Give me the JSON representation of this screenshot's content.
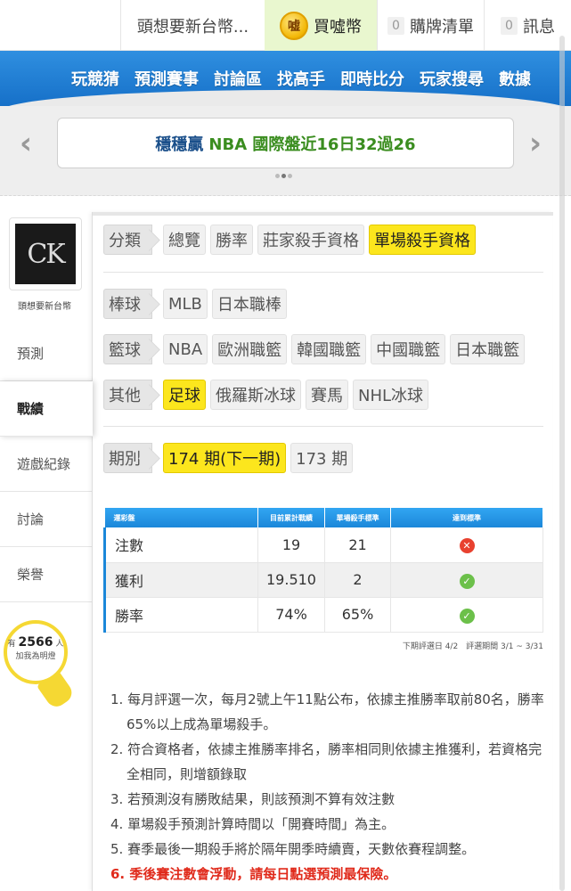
{
  "topbar": {
    "username": "頭想要新台幣...",
    "coin_icon_text": "嘘",
    "buy_label": "買噓幣",
    "list_count": "0",
    "list_label": "購牌清單",
    "msg_count": "0",
    "msg_label": "訊息"
  },
  "nav": {
    "items": [
      "玩競猜",
      "預測賽事",
      "討論區",
      "找高手",
      "即時比分",
      "玩家搜尋",
      "數據"
    ]
  },
  "banner": {
    "prev": "‹",
    "next": "›",
    "part1": "穩穩贏",
    "part2": "NBA 國際盤近16日32過26"
  },
  "sidebar": {
    "avatar_text": "CK",
    "username": "頭想要新台幣",
    "items": [
      "預測",
      "戰績",
      "遊戲紀錄",
      "討論",
      "榮譽"
    ],
    "bulb_prefix": "有",
    "bulb_count": "2566",
    "bulb_suffix": "人",
    "bulb_text": "加我為明燈"
  },
  "filters": {
    "category": {
      "label": "分類",
      "options": [
        "總覽",
        "勝率",
        "莊家殺手資格",
        "單場殺手資格"
      ],
      "selected": "單場殺手資格"
    },
    "baseball": {
      "label": "棒球",
      "options": [
        "MLB",
        "日本職棒"
      ]
    },
    "basketball": {
      "label": "籃球",
      "options": [
        "NBA",
        "歐洲職籃",
        "韓國職籃",
        "中國職籃",
        "日本職籃"
      ]
    },
    "other": {
      "label": "其他",
      "options": [
        "足球",
        "俄羅斯冰球",
        "賽馬",
        "NHL冰球"
      ],
      "selected": "足球"
    },
    "period": {
      "label": "期別",
      "options": [
        "174 期(下一期)",
        "173 期"
      ],
      "selected": "174 期(下一期)"
    }
  },
  "table": {
    "headers": [
      "運彩盤",
      "目前累計戰績",
      "單場殺手標準",
      "達到標準"
    ],
    "rows": [
      {
        "name": "注數",
        "current": "19",
        "standard": "21",
        "met": false
      },
      {
        "name": "獲利",
        "current": "19.510",
        "standard": "2",
        "met": true
      },
      {
        "name": "勝率",
        "current": "74%",
        "standard": "65%",
        "met": true
      }
    ],
    "fail_glyph": "✕",
    "pass_glyph": "✓"
  },
  "period_note": "下期評選日 4/2　評選期間 3/1 ~ 3/31",
  "rules": [
    "1. 每月評選一次，每月2號上午11點公布，依據主推勝率取前80名，勝率65%以上成為單場殺手。",
    "2. 符合資格者，依據主推勝率排名，勝率相同則依據主推獲利，若資格完全相同，則增額錄取",
    "3. 若預測沒有勝敗結果，則該預測不算有效注數",
    "4. 單場殺手預測計算時間以「開賽時間」為主。",
    "5. 賽季最後一期殺手將於隔年開季時續賣，天數依賽程調整。",
    "6. 季後賽注數會浮動，請每日點選預測最保險。"
  ],
  "colors": {
    "nav_blue": "#1670c8",
    "selected_chip": "#fce61d",
    "fail_red": "#e8412f",
    "pass_green": "#6cc04a",
    "warning_red": "#e02a1b"
  }
}
